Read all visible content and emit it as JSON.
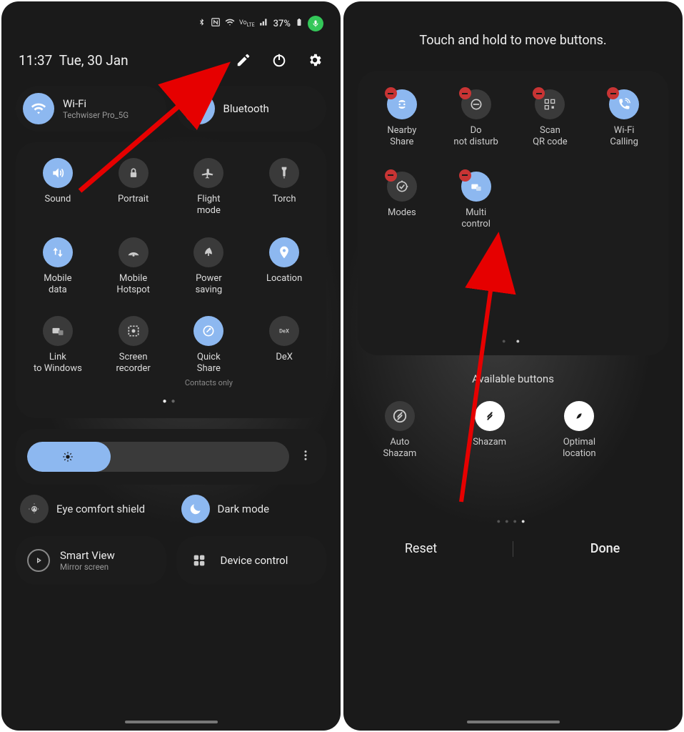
{
  "left": {
    "status": {
      "battery": "37%"
    },
    "time": "11:37",
    "date": "Tue, 30 Jan",
    "pills": {
      "wifi": {
        "title": "Wi-Fi",
        "sub": "Techwiser Pro_5G"
      },
      "bt": {
        "title": "Bluetooth"
      }
    },
    "tiles": [
      {
        "label": "Sound",
        "on": true,
        "icon": "volume"
      },
      {
        "label": "Portrait",
        "on": false,
        "icon": "lock"
      },
      {
        "label": "Flight mode",
        "on": false,
        "icon": "plane"
      },
      {
        "label": "Torch",
        "on": false,
        "icon": "torch"
      },
      {
        "label": "Mobile data",
        "on": true,
        "icon": "arrows"
      },
      {
        "label": "Mobile Hotspot",
        "on": false,
        "icon": "hotspot"
      },
      {
        "label": "Power saving",
        "on": false,
        "icon": "leaf"
      },
      {
        "label": "Location",
        "on": true,
        "icon": "pin"
      },
      {
        "label": "Link to Windows",
        "on": false,
        "icon": "link"
      },
      {
        "label": "Screen recorder",
        "on": false,
        "icon": "rec"
      },
      {
        "label": "Quick Share",
        "sub": "Contacts only",
        "on": true,
        "icon": "share"
      },
      {
        "label": "DeX",
        "on": false,
        "icon": "dex"
      }
    ],
    "modes": {
      "eye": "Eye comfort shield",
      "dark": "Dark mode"
    },
    "bottom": {
      "smartview": {
        "title": "Smart View",
        "sub": "Mirror screen"
      },
      "device": {
        "title": "Device control"
      }
    }
  },
  "right": {
    "title": "Touch and hold to move buttons.",
    "tiles": [
      {
        "label": "Nearby Share",
        "on": true,
        "icon": "nearby"
      },
      {
        "label": "Do not disturb",
        "on": false,
        "icon": "dnd"
      },
      {
        "label": "Scan QR code",
        "on": false,
        "icon": "qr"
      },
      {
        "label": "Wi-Fi Calling",
        "on": true,
        "icon": "wificall"
      },
      {
        "label": "Modes",
        "on": false,
        "icon": "modes"
      },
      {
        "label": "Multi control",
        "on": true,
        "icon": "multi"
      }
    ],
    "available_title": "Available buttons",
    "available": [
      {
        "label": "Auto Shazam",
        "icon": "shazam-o"
      },
      {
        "label": "Shazam",
        "icon": "shazam"
      },
      {
        "label": "Optimal location",
        "icon": "opt"
      }
    ],
    "reset": "Reset",
    "done": "Done"
  },
  "accent": "#8db8f0"
}
